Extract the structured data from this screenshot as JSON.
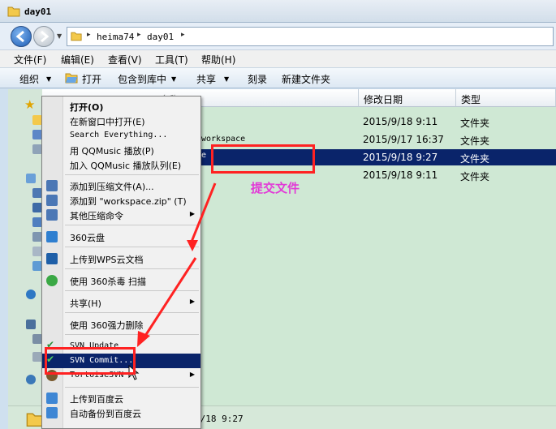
{
  "window": {
    "title": "day01"
  },
  "address": {
    "crumbs": [
      "heima74",
      "day01"
    ]
  },
  "menubar": [
    "文件(F)",
    "编辑(E)",
    "查看(V)",
    "工具(T)",
    "帮助(H)"
  ],
  "toolbar": {
    "organize": "组织",
    "open": "打开",
    "include": "包含到库中",
    "share": "共享",
    "burn": "刻录",
    "new_folder": "新建文件夹"
  },
  "columns": {
    "name_partial": "名称",
    "date": "修改日期",
    "type": "类型"
  },
  "rows": [
    {
      "name": "",
      "date": "2015/9/18 9:11",
      "type": "文件夹"
    },
    {
      "name": "workspace",
      "date": "2015/9/17 16:37",
      "type": "文件夹"
    },
    {
      "name": "e",
      "date": "2015/9/18 9:27",
      "type": "文件夹"
    },
    {
      "name": "",
      "date": "2015/9/18 9:11",
      "type": "文件夹"
    }
  ],
  "details": {
    "date": "9/18 9:27"
  },
  "context_menu": {
    "open": "打开(O)",
    "open_new_window": "在新窗口中打开(E)",
    "search_everything": "Search Everything...",
    "qqmusic_play": "用 QQMusic 播放(P)",
    "qqmusic_queue": "加入 QQMusic 播放队列(E)",
    "add_archive": "添加到压缩文件(A)...",
    "add_zip": "添加到 \"workspace.zip\" (T)",
    "other_compress": "其他压缩命令",
    "cloud360": "360云盘",
    "wps_upload": "上传到WPS云文档",
    "scan360": "使用 360杀毒 扫描",
    "share": "共享(H)",
    "delete360": "使用 360强力删除",
    "svn_update": "SVN Update",
    "svn_commit": "SVN Commit...",
    "tortoise": "TortoiseSVN",
    "baidu_upload": "上传到百度云",
    "baidu_backup": "自动备份到百度云"
  },
  "annotation": {
    "label": "提交文件",
    "color": "#e23bd7",
    "box_color": "#ff2222"
  },
  "colors": {
    "selection": "#0a246a",
    "pane_bg": "#cfe8d4"
  }
}
